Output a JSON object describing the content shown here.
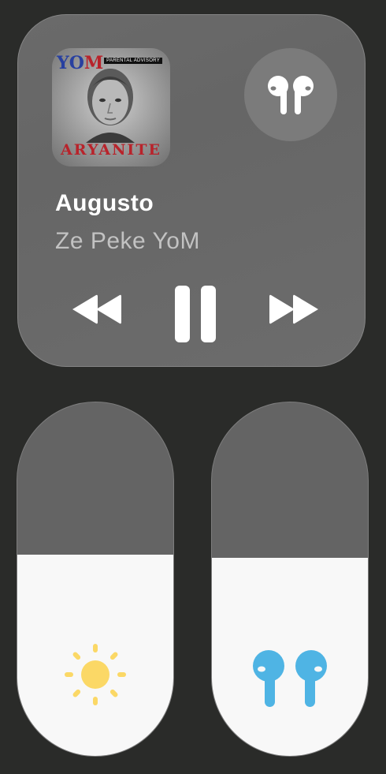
{
  "now_playing": {
    "track_title": "Augusto",
    "artist": "Ze Peke YoM",
    "album_art": {
      "brand_part1": "YO",
      "brand_part2": "M",
      "advisory": "PARENTAL ADVISORY",
      "caption": "ARYANITE"
    },
    "output_device_icon": "airpods-icon",
    "state": "playing"
  },
  "controls": {
    "previous_icon": "backward-icon",
    "pause_icon": "pause-icon",
    "next_icon": "forward-icon"
  },
  "brightness": {
    "icon": "sun-icon",
    "level": 0.57,
    "icon_color": "#fbd866"
  },
  "volume": {
    "icon": "airpods-icon",
    "level": 0.56,
    "icon_color": "#4fb4e4"
  }
}
